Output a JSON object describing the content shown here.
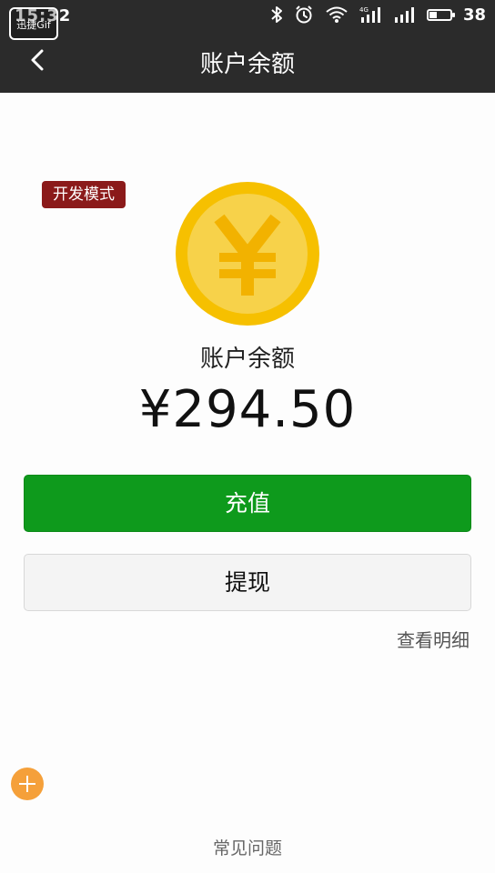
{
  "status_bar": {
    "time": "15:32",
    "overlay_badge": "迅捷Gif",
    "battery": "38",
    "battery_level": 0.38,
    "icons": [
      "bluetooth-icon",
      "alarm-icon",
      "wifi-icon",
      "4g-signal-icon",
      "signal-icon",
      "battery-icon"
    ]
  },
  "nav": {
    "title": "账户余额",
    "back_icon": "chevron-left-icon"
  },
  "badge": {
    "dev_mode": "开发模式"
  },
  "balance": {
    "label": "账户余额",
    "amount": "¥294.50",
    "coin_icon": "yuan-coin-icon"
  },
  "buttons": {
    "recharge": "充值",
    "withdraw": "提现"
  },
  "links": {
    "details": "查看明细",
    "faq": "常见问题"
  },
  "colors": {
    "topbar": "#2b2b2b",
    "primary_green": "#0e9a1c",
    "coin_outer": "#f6c000",
    "coin_inner": "#f7d24a",
    "badge_red": "#8b1a1a",
    "float_orange": "#f5a03a"
  }
}
